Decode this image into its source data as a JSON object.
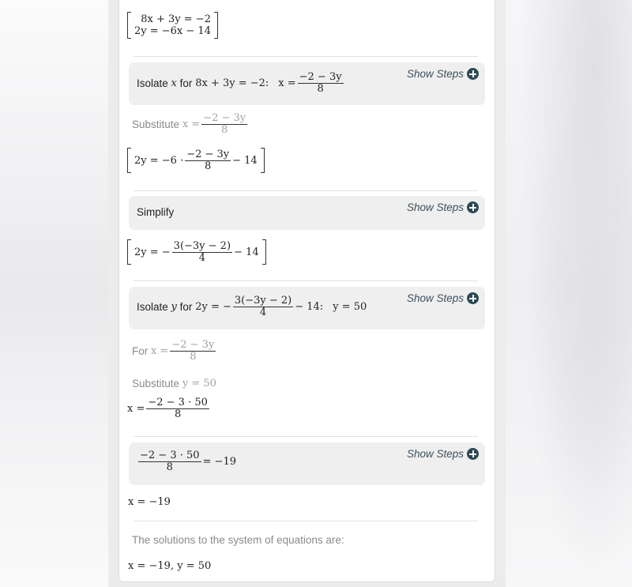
{
  "system": {
    "eq1": "8x + 3y = −2",
    "eq2": "2y = −6x − 14"
  },
  "steps": [
    {
      "label_prefix": "Isolate",
      "variable": "x",
      "label_for": "for",
      "equation": "8x + 3y = −2:",
      "result_lhs": "x =",
      "result_num": "−2 − 3y",
      "result_den": "8",
      "show_steps": "Show Steps"
    },
    {
      "label": "Simplify",
      "show_steps": "Show Steps"
    },
    {
      "label_prefix": "Isolate",
      "variable": "y",
      "label_for": "for",
      "equation_lhs": "2y = −",
      "equation_num": "3(−3y − 2)",
      "equation_den": "4",
      "equation_rest": "− 14:",
      "result": "y = 50",
      "show_steps": "Show Steps"
    },
    {
      "expr_num": "−2 − 3 · 50",
      "expr_den": "8",
      "result": "= −19",
      "show_steps": "Show Steps"
    }
  ],
  "substitute1": {
    "label": "Substitute",
    "lhs": "x =",
    "num": "−2 − 3y",
    "den": "8"
  },
  "bracket_eq1": {
    "lhs": "2y = −6 ·",
    "num": "−2 − 3y",
    "den": "8",
    "rest": "− 14"
  },
  "bracket_eq2": {
    "lhs": "2y = −",
    "num": "3(−3y − 2)",
    "den": "4",
    "rest": "− 14"
  },
  "for_x": {
    "label": "For",
    "lhs": "x =",
    "num": "−2 − 3y",
    "den": "8"
  },
  "substitute2": {
    "label": "Substitute",
    "expr": "y = 50"
  },
  "x_expr": {
    "lhs": "x =",
    "num": "−2 − 3 ·  50",
    "den": "8"
  },
  "x_result": "x =  −19",
  "solutions": {
    "text": "The solutions to the system of equations are:",
    "value": "x =  −19, y = 50"
  },
  "colors": {
    "step_bg": "#efefef",
    "icon": "#2c4a55",
    "show_steps_text": "#3d4f5c",
    "muted_text": "#8a8a8a"
  }
}
